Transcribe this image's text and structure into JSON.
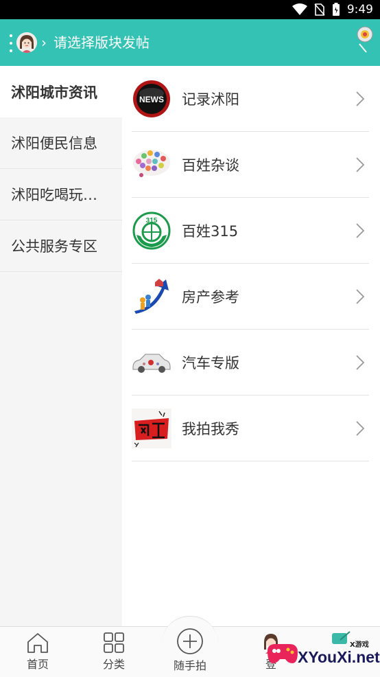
{
  "status_bar": {
    "time": "9:49"
  },
  "header": {
    "title": "请选择版块发帖"
  },
  "sidebar": {
    "items": [
      {
        "label": "沭阳城市资讯",
        "active": true
      },
      {
        "label": "沭阳便民信息",
        "active": false
      },
      {
        "label": "沭阳吃喝玩…",
        "active": false
      },
      {
        "label": "公共服务专区",
        "active": false
      }
    ]
  },
  "boards": [
    {
      "label": "记录沭阳",
      "icon": "news-icon"
    },
    {
      "label": "百姓杂谈",
      "icon": "speech-bubble-icon"
    },
    {
      "label": "百姓315",
      "icon": "consumer-315-icon"
    },
    {
      "label": "房产参考",
      "icon": "house-arrow-icon"
    },
    {
      "label": "汽车专版",
      "icon": "car-icon"
    },
    {
      "label": "我拍我秀",
      "icon": "wanghong-icon"
    }
  ],
  "bottom_nav": {
    "home": "首页",
    "category": "分类",
    "snap": "随手拍",
    "login": "登"
  },
  "watermark": {
    "text": "XYouXi.net",
    "small": "X游戏"
  },
  "colors": {
    "accent": "#33c2b3",
    "sidebar_bg": "#f5f5f5"
  }
}
